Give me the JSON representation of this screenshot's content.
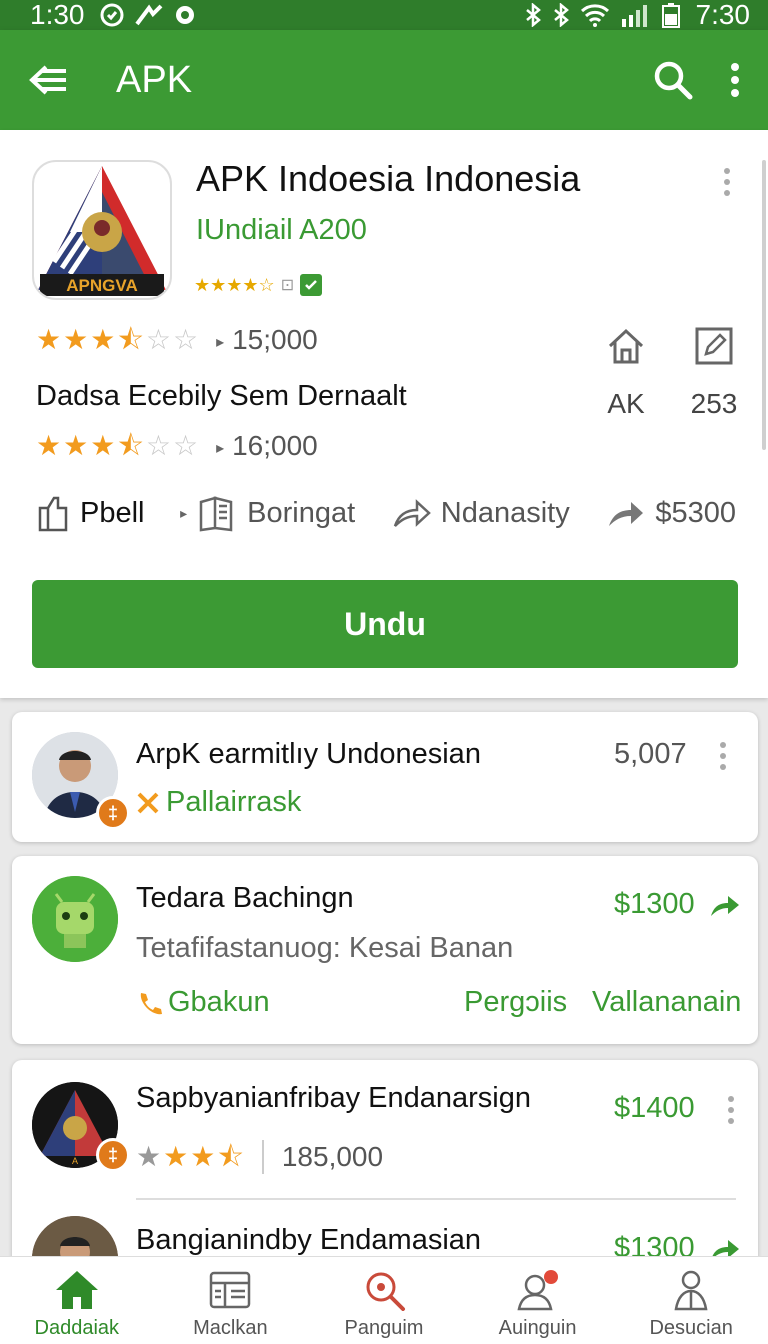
{
  "status_bar": {
    "time_left": "1:30",
    "time_right": "7:30"
  },
  "app_bar": {
    "title": "APK"
  },
  "app": {
    "icon_text": "APNGVA",
    "title": "APK Indoesia Indonesia",
    "subtitle": "IUndiail A200",
    "rating_1": {
      "stars": 3.5,
      "count": "15;000"
    },
    "description": "Dadsa Ecebily Sem Dernaalt",
    "rating_2": {
      "stars": 3.5,
      "count": "16;000"
    },
    "stat_left": "AK",
    "stat_right": "253",
    "actions": [
      "Pbell",
      "Boringat",
      "Ndanasity",
      "$5300"
    ],
    "install_label": "Undu"
  },
  "list": [
    {
      "title": "ArpK earmitlıy Undonesian",
      "tag": "Pallairrask",
      "count": "5,007"
    },
    {
      "title": "Tedara Bachingn",
      "price": "$1300",
      "line2": "Tetafifastanuog: Kesai Banan",
      "tag": "Gbakun",
      "link1": "Pergɔiis",
      "link2": "Vallananain"
    },
    {
      "title": "Sapbyanianfribay Endanarsign",
      "price": "$1400",
      "stars": 3.5,
      "count": "185,000"
    },
    {
      "title": "Bangianindby Endamasian",
      "price": "$1300"
    }
  ],
  "bottom_nav": [
    "Daddaiak",
    "Maclkan",
    "Panguim",
    "Auinguin",
    "Desucian"
  ],
  "colors": {
    "primary": "#3c9a34",
    "status_bar": "#2f7d2b",
    "star": "#f29b1e",
    "badge": "#e07a1a"
  }
}
